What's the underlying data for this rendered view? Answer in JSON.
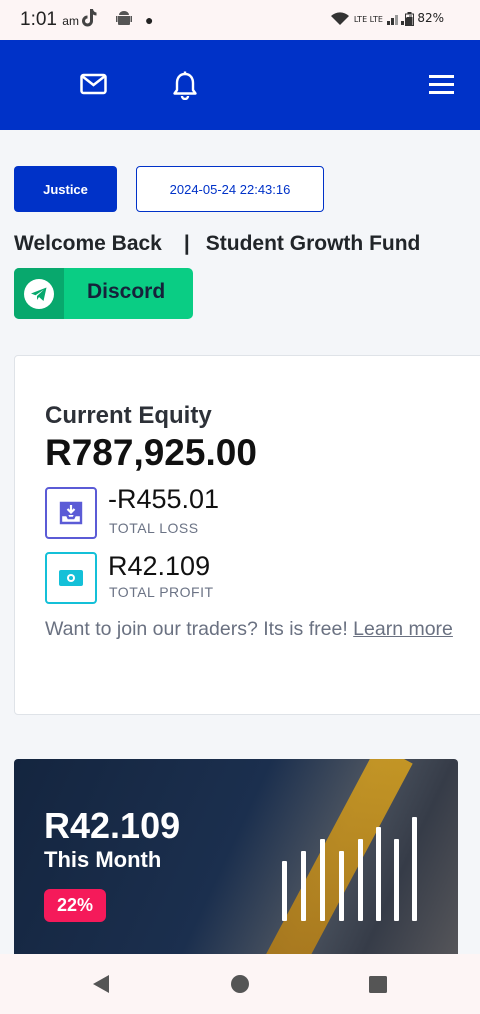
{
  "status_bar": {
    "time": "1:01",
    "ampm": "am",
    "network": "LTE LTE",
    "battery": "82%"
  },
  "nav": {
    "icons": [
      "mail-icon",
      "bell-icon",
      "menu-icon"
    ]
  },
  "user": {
    "name": "Justice",
    "datetime": "2024-05-24 22:43:16"
  },
  "welcome": {
    "greeting": "Welcome Back",
    "separator": "|",
    "fund": "Student Growth Fund"
  },
  "discord": {
    "label": "Discord"
  },
  "equity": {
    "label": "Current Equity",
    "value": "R787,925.00",
    "loss_value": "-R455.01",
    "loss_label": "TOTAL LOSS",
    "profit_value": "R42.109",
    "profit_label": "TOTAL PROFIT",
    "join_text": "Want to join our traders? Its is free!",
    "join_link": "Learn more"
  },
  "month": {
    "value": "R42.109",
    "label": "This Month",
    "percent": "22%"
  },
  "colors": {
    "primary": "#0032c8",
    "discord": "#0acd84",
    "badge": "#f51a5a",
    "loss_icon": "#5b5bd6",
    "profit_icon": "#14c0d8"
  }
}
